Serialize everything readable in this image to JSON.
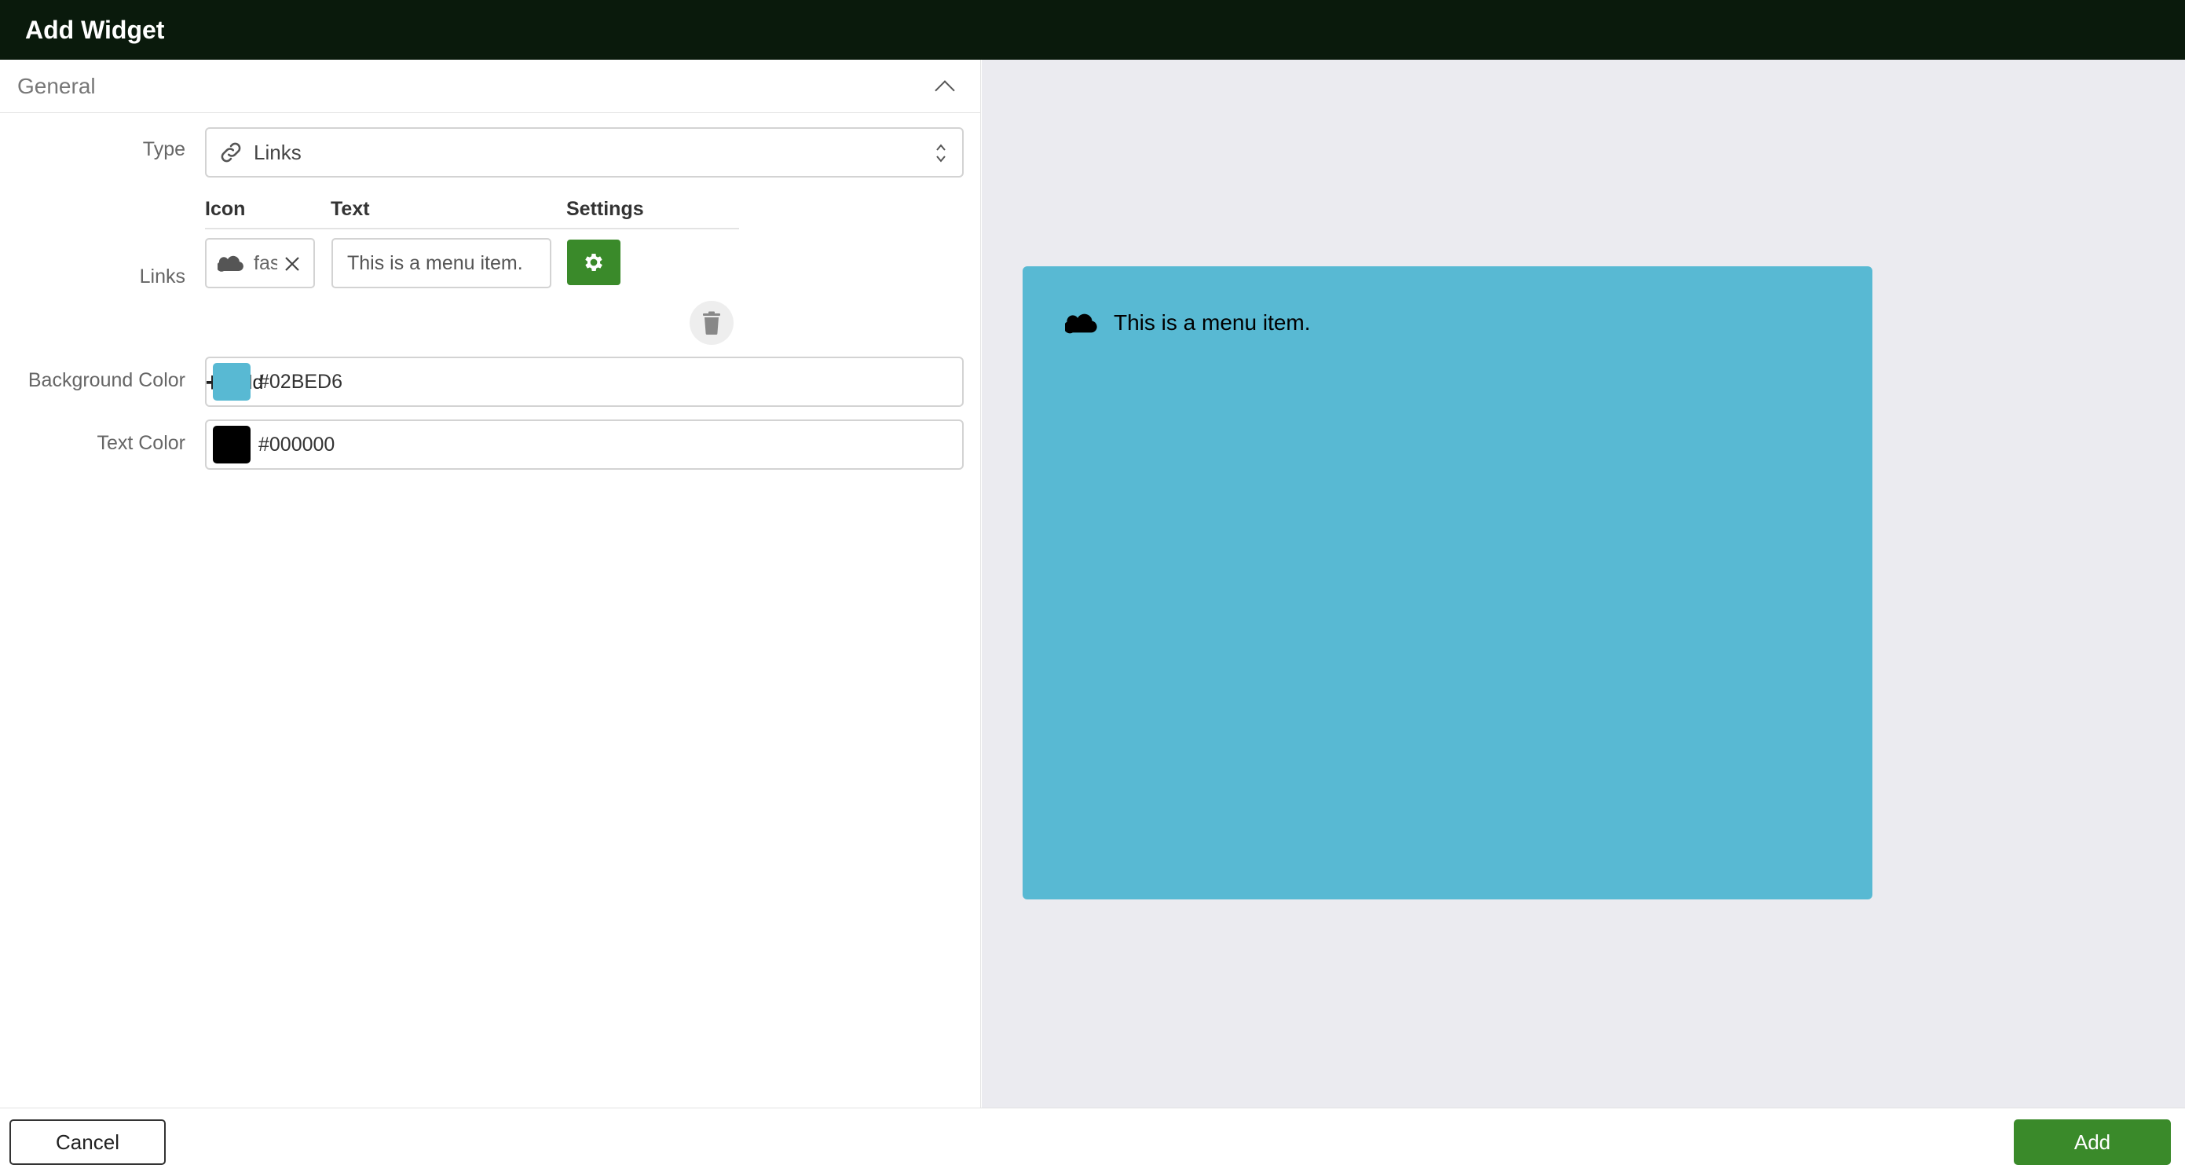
{
  "window": {
    "title": "Add Widget"
  },
  "section": {
    "title": "General"
  },
  "form": {
    "type": {
      "label": "Type",
      "value": "Links",
      "icon": "link-icon"
    },
    "links": {
      "label": "Links",
      "columns": {
        "icon": "Icon",
        "text": "Text",
        "settings": "Settings"
      },
      "items": [
        {
          "icon": "cloud-icon",
          "icon_value": "fas",
          "text": "This is a menu item."
        }
      ],
      "add_label": "Add"
    },
    "background_color": {
      "label": "Background Color",
      "value": "#02BED6",
      "swatch": "#58b9d3"
    },
    "text_color": {
      "label": "Text Color",
      "value": "#000000",
      "swatch": "#000000"
    }
  },
  "preview": {
    "background": "#58b9d3",
    "items": [
      {
        "icon": "cloud-icon",
        "text": "This is a menu item."
      }
    ]
  },
  "footer": {
    "cancel_label": "Cancel",
    "add_label": "Add"
  },
  "colors": {
    "brand_green": "#3a8a2a",
    "titlebar": "#0a1a0c",
    "preview_bg": "#ebebf0"
  }
}
